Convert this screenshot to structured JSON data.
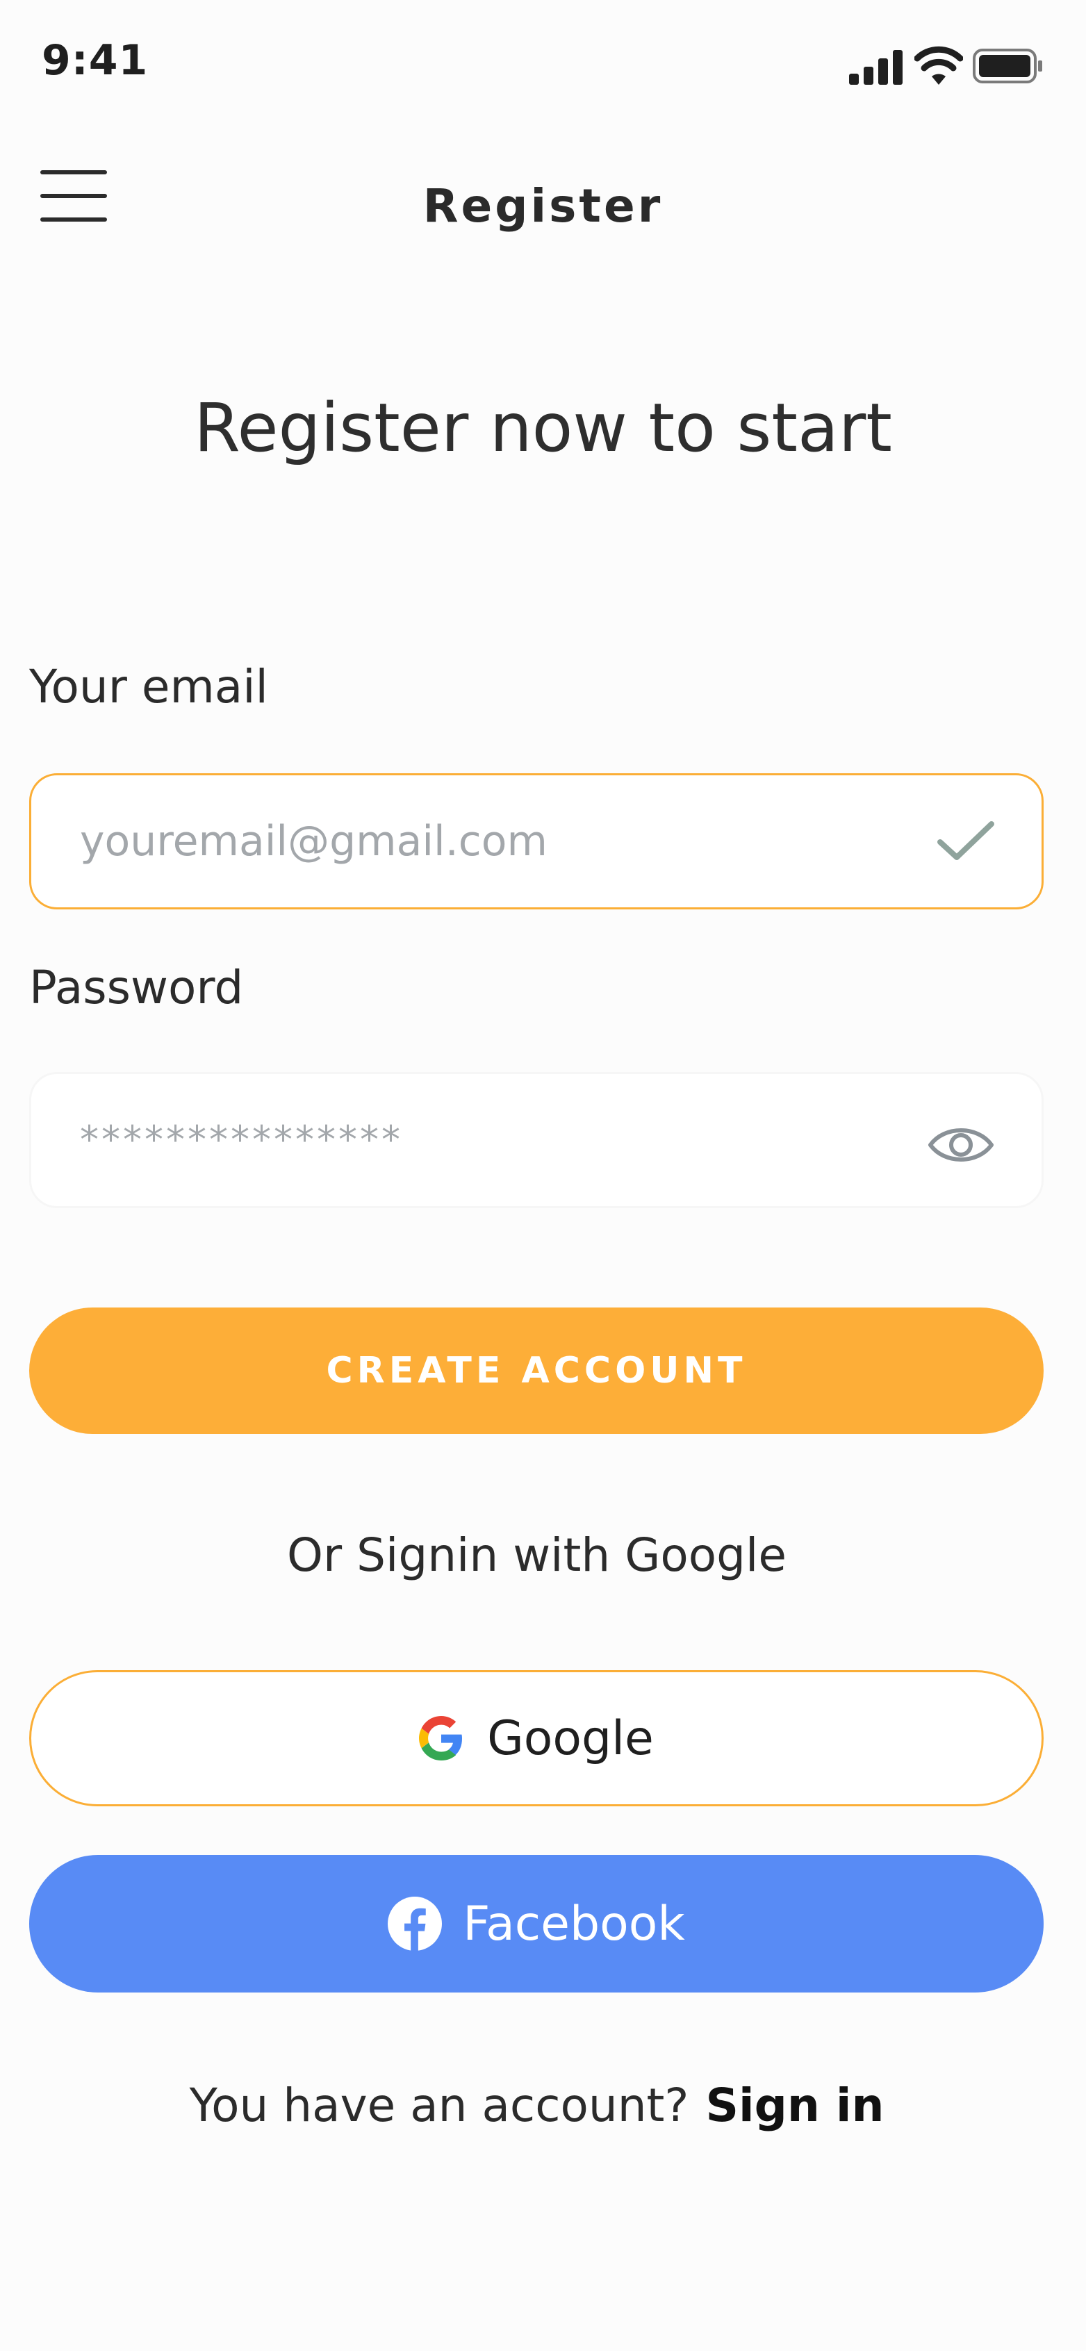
{
  "status_bar": {
    "time": "9:41",
    "icons": [
      "signal-icon",
      "wifi-icon",
      "battery-icon"
    ]
  },
  "header": {
    "menu_icon": "menu-icon",
    "title": "Register"
  },
  "headline": "Register now to start",
  "form": {
    "email_label": "Your email",
    "email_placeholder": "youremail@gmail.com",
    "email_status_icon": "check-icon",
    "password_label": "Password",
    "password_value": "***************",
    "password_toggle_icon": "eye-icon",
    "submit_label": "CREATE ACCOUNT"
  },
  "social": {
    "divider_text": "Or Signin with Google",
    "google_label": "Google",
    "facebook_label": "Facebook"
  },
  "footer": {
    "prompt": "You have an account?",
    "link": "Sign in"
  },
  "colors": {
    "accent": "#fdae38",
    "facebook": "#588bf5",
    "background": "#fcfcfc",
    "text": "#2b2b2b",
    "placeholder": "#a3a7ab"
  }
}
